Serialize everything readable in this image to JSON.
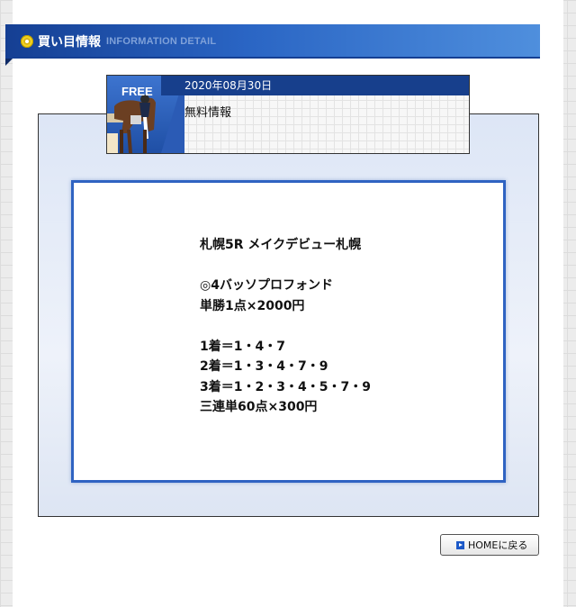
{
  "section": {
    "title": "買い目情報",
    "subtitle": "INFORMATION DETAIL"
  },
  "card": {
    "badge": "FREE",
    "date": "2020年08月30日",
    "title": "無料情報"
  },
  "content": {
    "lines": [
      "札幌5R メイクデビュー札幌",
      "",
      "◎4バッソプロフォンド",
      "単勝1点×2000円",
      "",
      "1着＝1・4・7",
      "2着＝1・3・4・7・9",
      "3着＝1・2・3・4・5・7・9",
      "三連単60点×300円"
    ]
  },
  "footer": {
    "home_button": "HOMEに戻る"
  },
  "colors": {
    "header_blue": "#153f93",
    "accent_blue": "#2f63c2",
    "icon_yellow": "#f2d21b"
  }
}
